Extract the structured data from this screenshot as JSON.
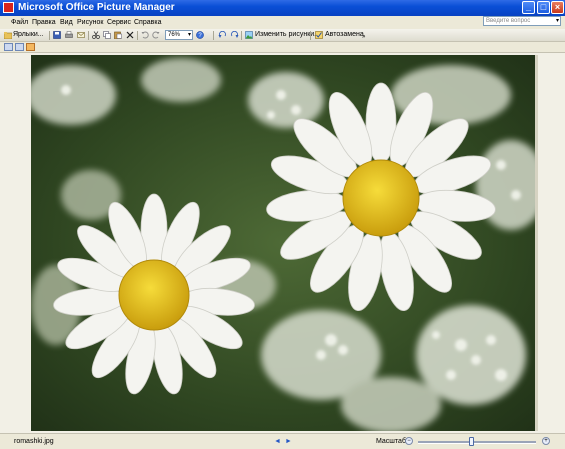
{
  "window": {
    "title": "Microsoft Office Picture Manager",
    "controls": {
      "minimize": "_",
      "maximize": "□",
      "close": "×"
    }
  },
  "menu": [
    {
      "label": "Файл"
    },
    {
      "label": "Правка"
    },
    {
      "label": "Вид"
    },
    {
      "label": "Рисунок"
    },
    {
      "label": "Сервис"
    },
    {
      "label": "Справка"
    }
  ],
  "help_search": {
    "placeholder": "Введите вопрос",
    "arrow": "▾"
  },
  "toolbar": {
    "shortcuts_label": "Ярлыки...",
    "zoom_value": "76%",
    "zoom_arrow": "▾",
    "edit_picture_label": "Изменить рисунки...",
    "autocorrect_label": "Автозамена",
    "more_arrow": "»"
  },
  "icons": {
    "shortcuts": "folder-shortcuts-icon",
    "save": "save-icon",
    "print": "print-icon",
    "email": "email-icon",
    "cut": "cut-icon",
    "copy": "copy-icon",
    "paste": "paste-icon",
    "delete": "delete-icon",
    "undo": "undo-icon",
    "redo": "redo-icon",
    "zoom": "zoom-icon",
    "help": "help-icon",
    "rotate_left": "rotate-left-icon",
    "rotate_right": "rotate-right-icon"
  },
  "views": [
    "thumbnail-view",
    "filmstrip-view",
    "single-picture-view"
  ],
  "image": {
    "description_name": "daisies photo"
  },
  "status": {
    "filename": "romashki.jpg",
    "prev": "◄",
    "next": "►",
    "zoom_label": "Масштаб:",
    "zoom_minus": "−",
    "zoom_plus": "+",
    "zoom_slider_fraction": 0.45
  },
  "colors": {
    "titlebar": "#0a4fd6",
    "chrome": "#ece9d8",
    "daisy_center": "#e9c71a"
  }
}
